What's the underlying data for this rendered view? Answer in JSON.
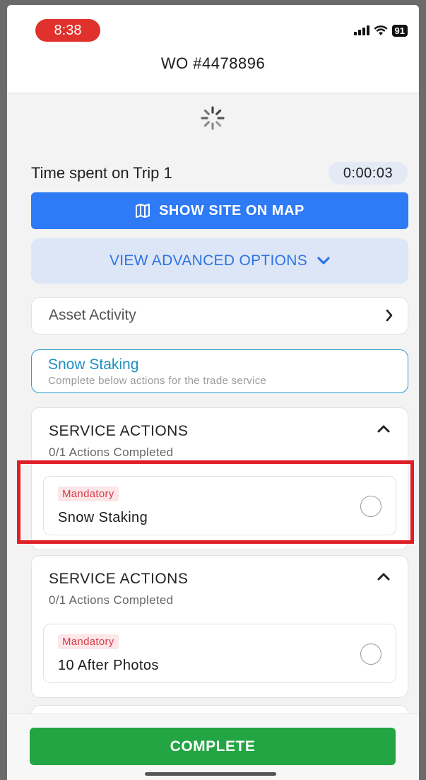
{
  "status_bar": {
    "time": "8:38",
    "battery": "91",
    "icons": [
      "signal-icon",
      "wifi-icon",
      "battery-icon"
    ],
    "time_pill_color": "#e0312c"
  },
  "header": {
    "title": "WO #4478896"
  },
  "loading_indicator": "spinner-icon",
  "timer": {
    "label": "Time spent on Trip 1",
    "value": "0:00:03"
  },
  "map_button": {
    "label": "SHOW SITE ON MAP",
    "icon": "map-icon",
    "color": "#2f7af5"
  },
  "advanced_options": {
    "label": "VIEW ADVANCED OPTIONS",
    "icon": "chevron-down-icon"
  },
  "asset_activity": {
    "label": "Asset Activity",
    "icon": "chevron-right-icon"
  },
  "trade_service": {
    "title": "Snow Staking",
    "subtitle": "Complete below actions for the trade service"
  },
  "service_sections": [
    {
      "title": "SERVICE ACTIONS",
      "progress": "0/1 Actions Completed",
      "action": {
        "badge": "Mandatory",
        "name": "Snow Staking",
        "completed": false
      }
    },
    {
      "title": "SERVICE ACTIONS",
      "progress": "0/1 Actions Completed",
      "action": {
        "badge": "Mandatory",
        "name": "10 After Photos",
        "completed": false
      }
    }
  ],
  "footer": {
    "complete_label": "COMPLETE",
    "complete_color": "#23a544"
  },
  "highlight_color": "#e01e25"
}
